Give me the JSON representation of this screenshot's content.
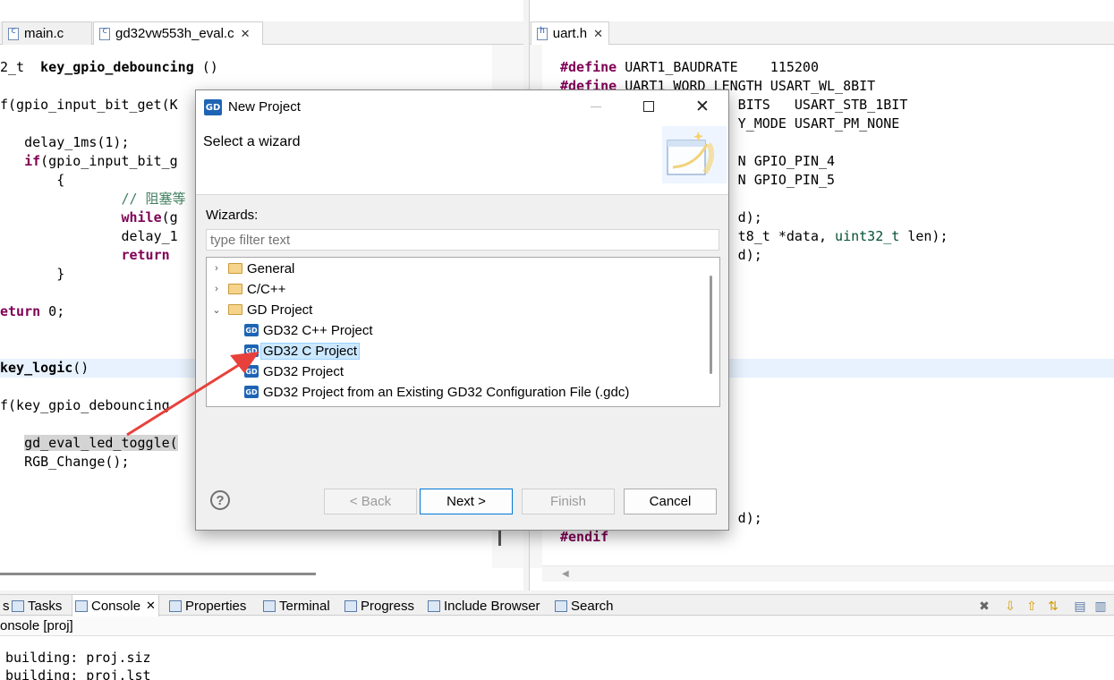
{
  "editor_left": {
    "tabs": [
      {
        "label": "main.c",
        "active": false
      },
      {
        "label": "gd32vw553h_eval.c",
        "active": true,
        "close": "✕"
      }
    ],
    "lines": [
      "2_t  key_gpio_debouncing ()",
      "",
      "f(gpio_input_bit_get(K",
      "",
      "   delay_1ms(1);",
      "   if(gpio_input_bit_g",
      "       {",
      "               // 阻塞等",
      "               while(g",
      "               delay_1",
      "               return ",
      "       }",
      "",
      "eturn 0;",
      "",
      "",
      "key_logic()",
      "",
      "f(key_gpio_debouncing",
      "",
      "   gd_eval_led_toggle(",
      "   RGB_Change();"
    ]
  },
  "editor_right": {
    "tabs": [
      {
        "label": "uart.h",
        "active": true,
        "close": "✕"
      }
    ],
    "lines": [
      "#define UART1_BAUDRATE    115200",
      "#define UART1_WORD_LENGTH USART_WL_8BIT",
      "                      BITS   USART_STB_1BIT",
      "                      Y_MODE USART_PM_NONE",
      "",
      "                      N GPIO_PIN_4",
      "                      N GPIO_PIN_5",
      "",
      "                      d);",
      "                      t8_t *data, uint32_t len);",
      "                      d);"
    ],
    "lines_bottom": [
      "                      d);",
      "#endif"
    ]
  },
  "dialog": {
    "title": "New Project",
    "header": "Select a wizard",
    "wizards_label": "Wizards:",
    "filter_placeholder": "type filter text",
    "tree": [
      {
        "label": "General",
        "kind": "folder",
        "twisty": "›"
      },
      {
        "label": "C/C++",
        "kind": "folder",
        "twisty": "›"
      },
      {
        "label": "GD Project",
        "kind": "folder",
        "twisty": "⌄"
      },
      {
        "label": "GD32 C++ Project",
        "kind": "gd"
      },
      {
        "label": "GD32 C Project",
        "kind": "gd",
        "selected": true
      },
      {
        "label": "GD32 Project",
        "kind": "gd"
      },
      {
        "label": "GD32 Project from an Existing GD32 Configuration File (.gdc)",
        "kind": "gd"
      }
    ],
    "buttons": {
      "back": "< Back",
      "next": "Next >",
      "finish": "Finish",
      "cancel": "Cancel"
    },
    "help_icon": "?",
    "logo_text": "GD"
  },
  "bottom_tabs": [
    {
      "label": "s",
      "icon": "none"
    },
    {
      "label": "Tasks",
      "icon": "tasks-icon"
    },
    {
      "label": "Console",
      "icon": "console-icon",
      "active": true,
      "close": "✕"
    },
    {
      "label": "Properties",
      "icon": "properties-icon"
    },
    {
      "label": "Terminal",
      "icon": "terminal-icon"
    },
    {
      "label": "Progress",
      "icon": "progress-icon"
    },
    {
      "label": "Include Browser",
      "icon": "include-browser-icon"
    },
    {
      "label": "Search",
      "icon": "search-icon"
    }
  ],
  "console": {
    "title": "onsole [proj]",
    "lines": [
      "building: proj.siz",
      "building: proj.lst"
    ]
  },
  "colors": {
    "accent": "#0078d7",
    "arrow": "#e8413c",
    "gd_blue": "#1e64b4"
  }
}
